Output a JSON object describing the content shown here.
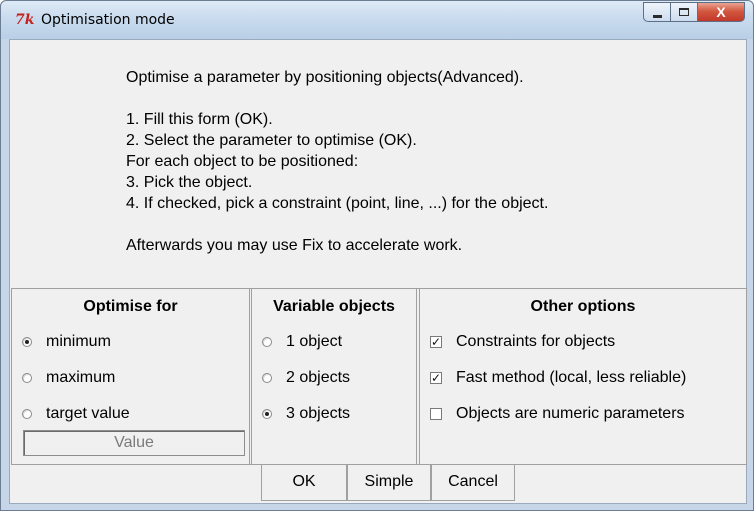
{
  "window": {
    "logo_text": "7k",
    "title": "Optimisation mode",
    "controls": {
      "minimize": "minimize",
      "maximize": "maximize",
      "close": "X"
    }
  },
  "instructions": [
    "Optimise a parameter by positioning objects(Advanced).",
    "",
    "1. Fill this form (OK).",
    "2. Select the parameter to optimise (OK).",
    "For each object to be positioned:",
    "3. Pick the object.",
    "4. If checked, pick a constraint (point, line, ...) for the object.",
    "",
    "Afterwards you may use Fix to accelerate work."
  ],
  "optimise_for": {
    "heading": "Optimise for",
    "options": [
      {
        "label": "minimum",
        "selected": true
      },
      {
        "label": "maximum",
        "selected": false
      },
      {
        "label": "target value",
        "selected": false
      }
    ],
    "value_placeholder": "Value"
  },
  "variable_objects": {
    "heading": "Variable objects",
    "options": [
      {
        "label": "1 object",
        "selected": false
      },
      {
        "label": "2 objects",
        "selected": false
      },
      {
        "label": "3 objects",
        "selected": true
      }
    ]
  },
  "other_options": {
    "heading": "Other options",
    "options": [
      {
        "label": "Constraints for objects",
        "checked": true
      },
      {
        "label": "Fast method (local, less reliable)",
        "checked": true
      },
      {
        "label": "Objects are numeric parameters",
        "checked": false
      }
    ]
  },
  "buttons": {
    "ok": "OK",
    "simple": "Simple",
    "cancel": "Cancel"
  },
  "colors": {
    "title_bar": "#c9dbee",
    "client_bg": "#f0f0f0",
    "close_button": "#c1382a",
    "logo": "#c8201c"
  }
}
